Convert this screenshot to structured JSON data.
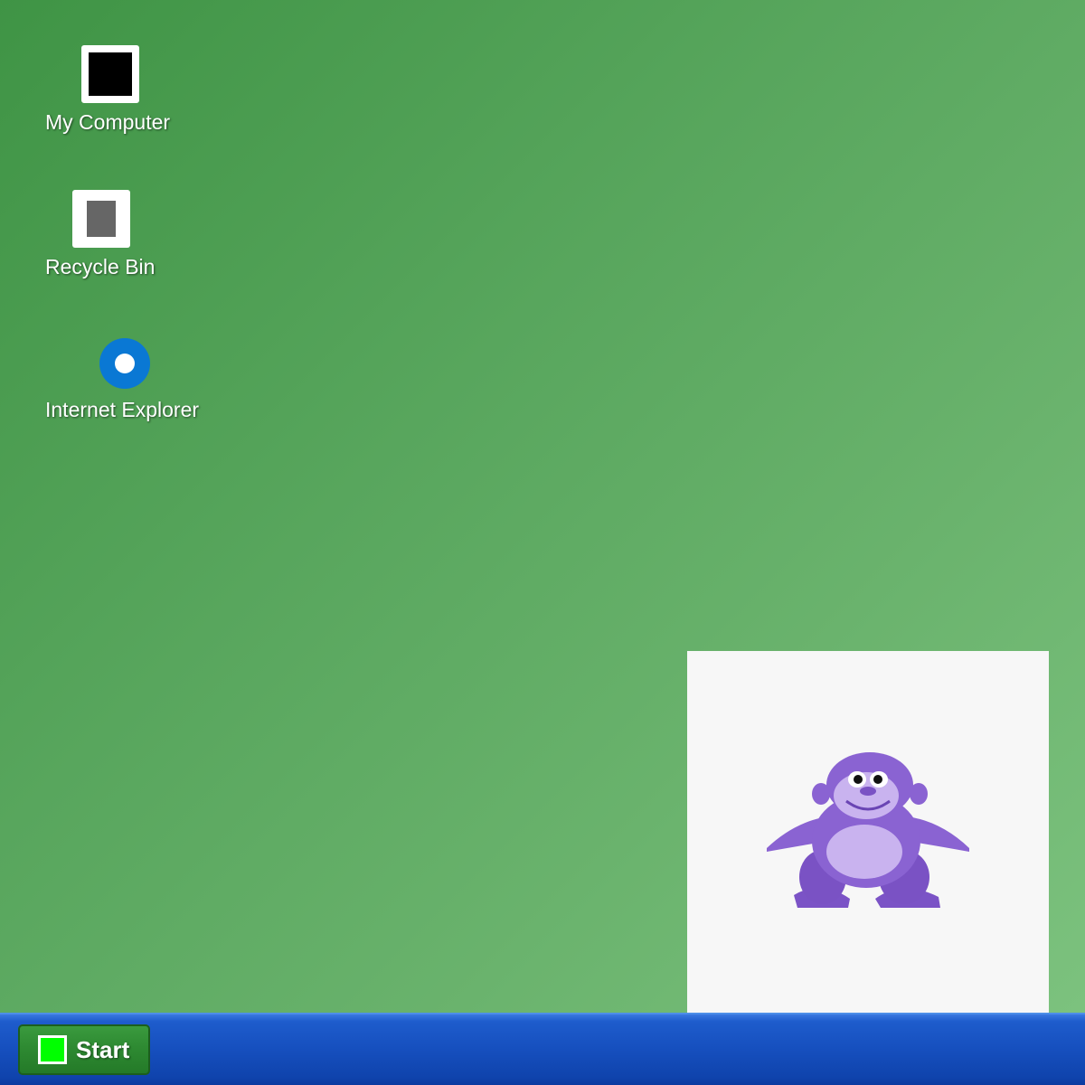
{
  "desktop": {
    "background_color": "#58a65d",
    "icons": [
      {
        "label": "My Computer",
        "icon": "computer-icon"
      },
      {
        "label": "Recycle Bin",
        "icon": "recycle-bin-icon"
      },
      {
        "label": "Internet Explorer",
        "icon": "internet-explorer-icon"
      }
    ]
  },
  "bonzi": {
    "icon": "bonzi-buddy-gorilla",
    "body_color": "#8a63d2",
    "window_color": "#f7f7f7"
  },
  "taskbar": {
    "color": "#164fbe",
    "start_label": "Start",
    "start_logo_color": "#00ff00",
    "start_button_color": "#2e8a32"
  }
}
